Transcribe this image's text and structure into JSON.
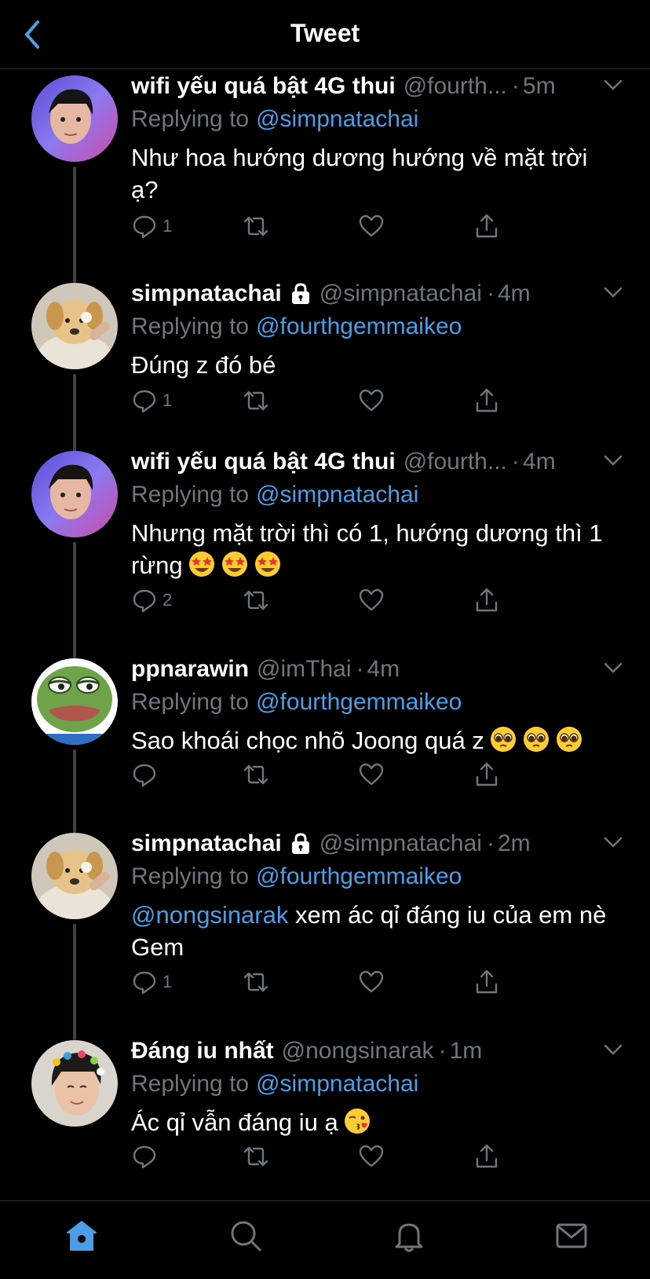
{
  "header": {
    "title": "Tweet",
    "back_icon": "chevron-left-icon",
    "accent": "#4a9ee8"
  },
  "replying_label": "Replying to",
  "tweets": [
    {
      "name": "wifi yếu quá bật 4G thui",
      "handle": "@fourth...",
      "time": "5m",
      "replying_to": "@simpnatachai",
      "text": "Như hoa hướng dương hướng về mặt trời ạ?",
      "reply_count": "1",
      "avatar": "person-avatar",
      "locked": false
    },
    {
      "name": "simpnatachai",
      "handle": "@simpnatachai",
      "time": "4m",
      "replying_to": "@fourthgemmaikeo",
      "text": "Đúng z đó bé",
      "reply_count": "1",
      "avatar": "puppy-avatar",
      "locked": true
    },
    {
      "name": "wifi yếu quá bật 4G thui",
      "handle": "@fourth...",
      "time": "4m",
      "replying_to": "@simpnatachai",
      "text": "Nhưng mặt trời thì có 1, hướng dương thì 1 rừng",
      "emojis": [
        "star-struck-emoji",
        "star-struck-emoji",
        "star-struck-emoji"
      ],
      "reply_count": "2",
      "avatar": "person-avatar",
      "locked": false
    },
    {
      "name": "ppnarawin",
      "handle": "@imThai",
      "time": "4m",
      "replying_to": "@fourthgemmaikeo",
      "text": "Sao khoái chọc nhõ Joong quá z",
      "emojis": [
        "pleading-face-emoji",
        "pleading-face-emoji",
        "pleading-face-emoji"
      ],
      "reply_count": "",
      "avatar": "frog-avatar",
      "locked": false
    },
    {
      "name": "simpnatachai",
      "handle": "@simpnatachai",
      "time": "2m",
      "replying_to": "@fourthgemmaikeo",
      "text_mention": "@nongsinarak",
      "text": "xem ác qỉ đáng iu của em nè Gem",
      "reply_count": "1",
      "avatar": "puppy-avatar",
      "locked": true
    },
    {
      "name": "Đáng iu nhất",
      "handle": "@nongsinarak",
      "time": "1m",
      "replying_to": "@simpnatachai",
      "text": "Ác qỉ vẫn đáng iu ạ",
      "emojis": [
        "kissing-face-emoji"
      ],
      "reply_count": "",
      "avatar": "person-clips-avatar",
      "locked": false
    }
  ],
  "tabbar": {
    "items": [
      "home-icon",
      "search-icon",
      "notifications-icon",
      "messages-icon"
    ],
    "active": "home-icon"
  }
}
